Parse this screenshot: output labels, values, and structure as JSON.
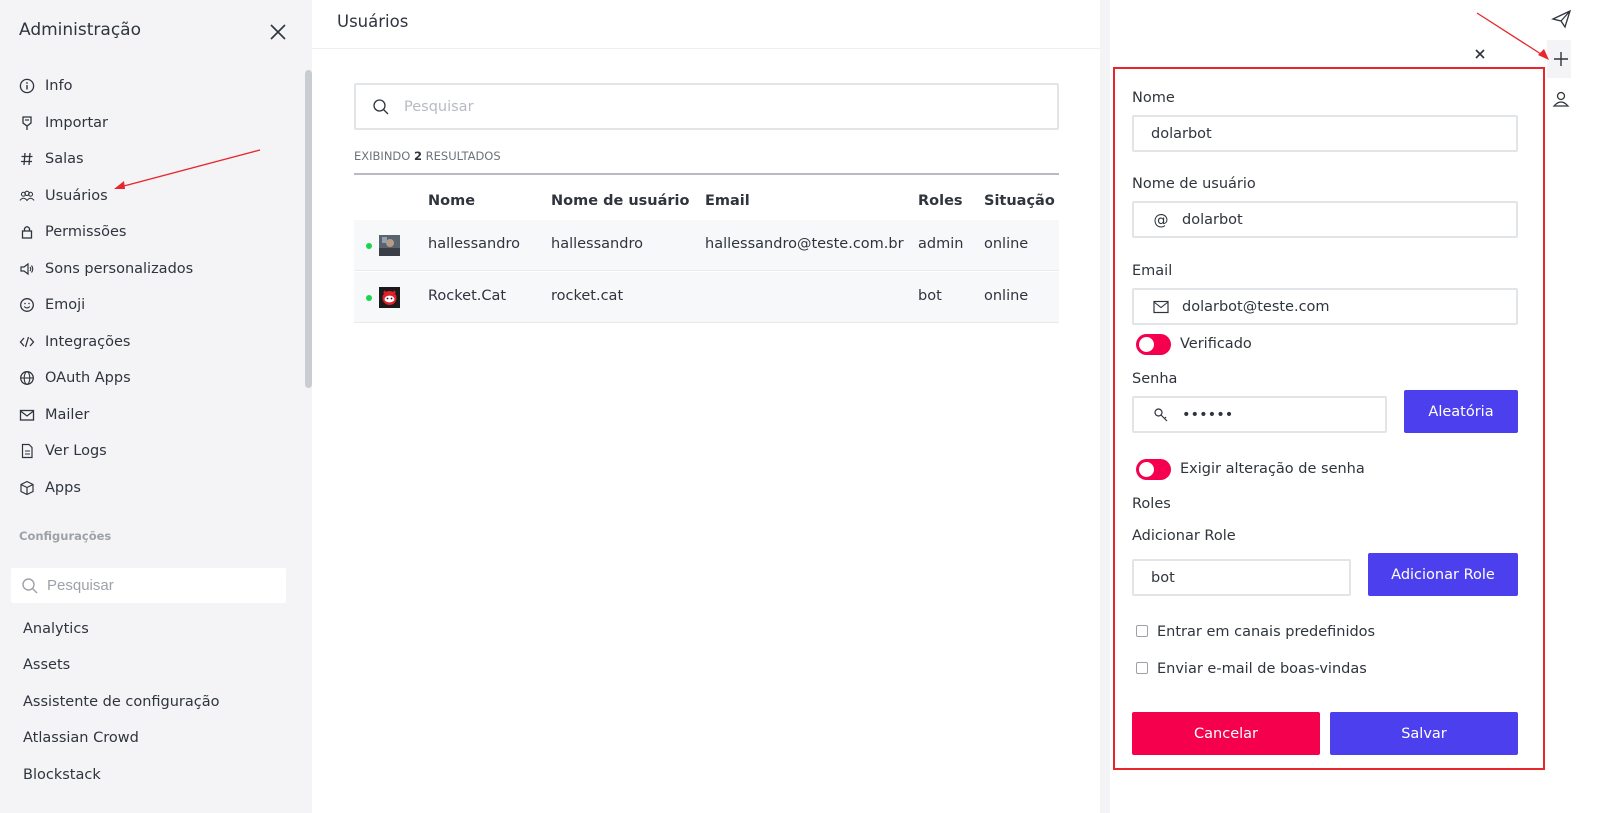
{
  "sidebar": {
    "title": "Administração",
    "items": [
      {
        "label": "Info",
        "icon": "info-icon"
      },
      {
        "label": "Importar",
        "icon": "import-icon"
      },
      {
        "label": "Salas",
        "icon": "hashtag-icon"
      },
      {
        "label": "Usuários",
        "icon": "team-icon"
      },
      {
        "label": "Permissões",
        "icon": "lock-icon"
      },
      {
        "label": "Sons personalizados",
        "icon": "volume-icon"
      },
      {
        "label": "Emoji",
        "icon": "emoji-icon"
      },
      {
        "label": "Integrações",
        "icon": "code-icon"
      },
      {
        "label": "OAuth Apps",
        "icon": "globe-icon"
      },
      {
        "label": "Mailer",
        "icon": "mail-icon"
      },
      {
        "label": "Ver Logs",
        "icon": "file-icon"
      },
      {
        "label": "Apps",
        "icon": "cube-icon"
      }
    ],
    "section_title": "Configurações",
    "search_placeholder": "Pesquisar",
    "settings": [
      "Analytics",
      "Assets",
      "Assistente de configuração",
      "Atlassian Crowd",
      "Blockstack"
    ]
  },
  "main": {
    "title": "Usuários",
    "search_placeholder": "Pesquisar",
    "results_prefix": "EXIBINDO",
    "results_count": "2",
    "results_suffix": "RESULTADOS",
    "columns": [
      "Nome",
      "Nome de usuário",
      "Email",
      "Roles",
      "Situação"
    ],
    "rows": [
      {
        "name": "hallessandro",
        "username": "hallessandro",
        "email": "hallessandro@teste.com.br",
        "roles": "admin",
        "status": "online"
      },
      {
        "name": "Rocket.Cat",
        "username": "rocket.cat",
        "email": "",
        "roles": "bot",
        "status": "online"
      }
    ]
  },
  "form": {
    "name_label": "Nome",
    "name_value": "dolarbot",
    "username_label": "Nome de usuário",
    "username_prefix": "@",
    "username_value": "dolarbot",
    "email_label": "Email",
    "email_value": "dolarbot@teste.com",
    "verified_label": "Verificado",
    "password_label": "Senha",
    "password_value": "••••••",
    "random_button": "Aleatória",
    "require_change_label": "Exigir alteração de senha",
    "roles_label": "Roles",
    "add_role_label": "Adicionar Role",
    "role_value": "bot",
    "add_role_button": "Adicionar Role",
    "join_default_label": "Entrar em canais predefinidos",
    "welcome_email_label": "Enviar e-mail de boas-vindas",
    "cancel_button": "Cancelar",
    "save_button": "Salvar"
  },
  "colors": {
    "primary": "#4c3fee",
    "danger": "#f5004d",
    "online": "#19d64f",
    "highlight": "#e8262d"
  }
}
